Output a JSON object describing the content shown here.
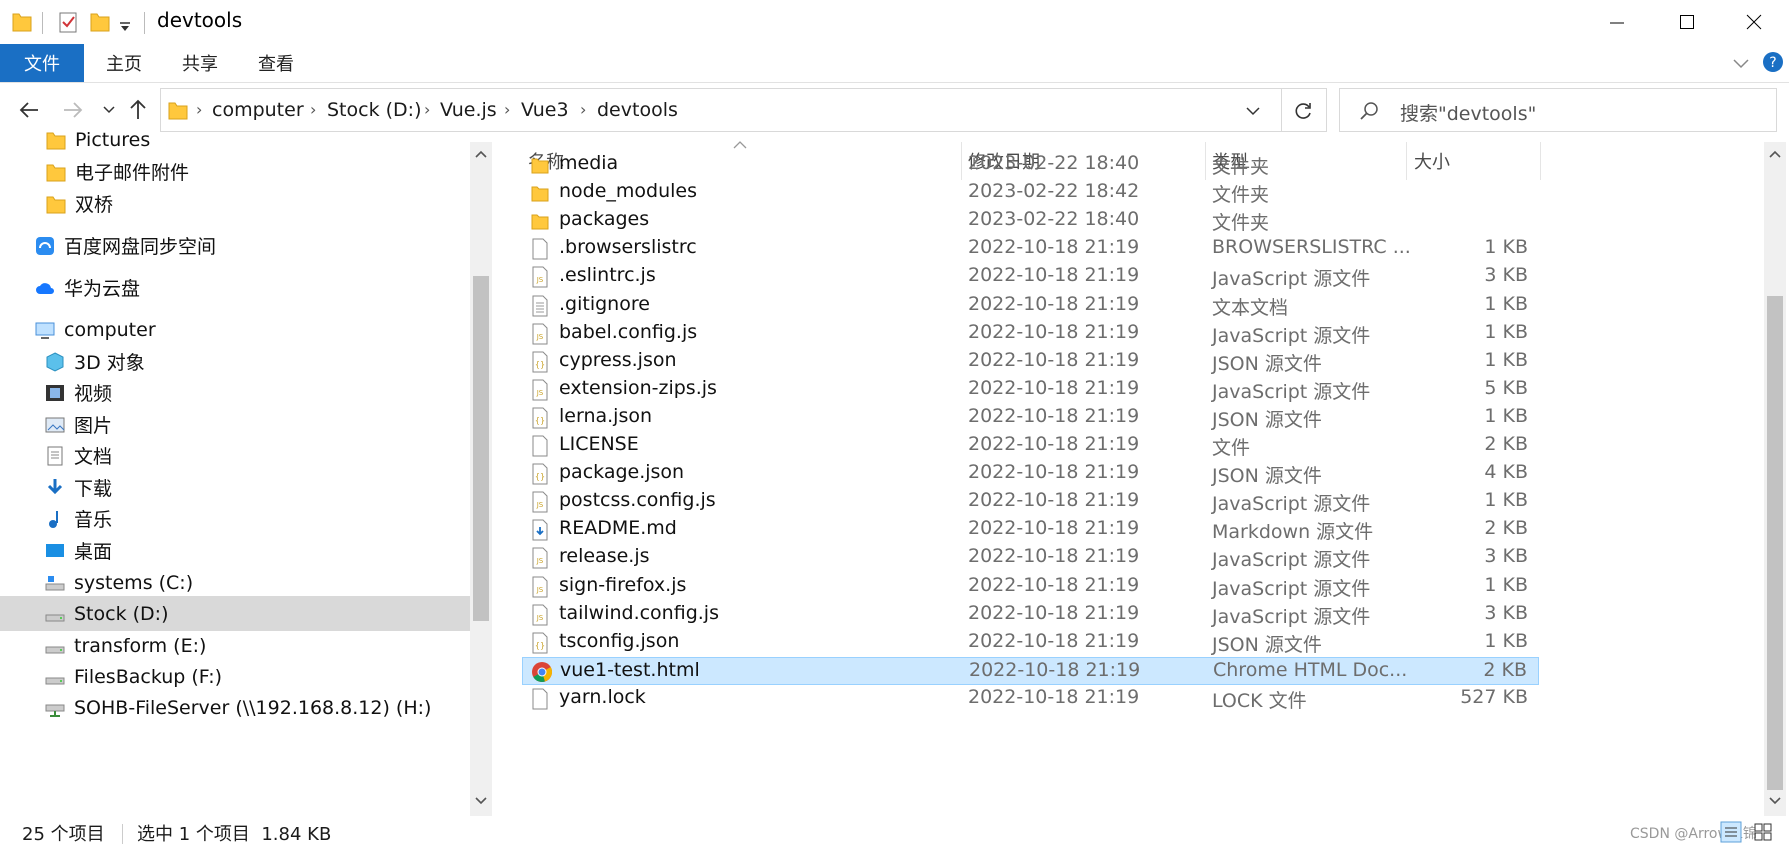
{
  "window": {
    "title": "devtools"
  },
  "ribbon": {
    "tabs": [
      "文件",
      "主页",
      "共享",
      "查看"
    ]
  },
  "breadcrumb": [
    "computer",
    "Stock (D:)",
    "Vue.js",
    "Vue3",
    "devtools"
  ],
  "search": {
    "placeholder": "搜索\"devtools\""
  },
  "nav": [
    {
      "label": "Pictures",
      "icon": "folder-icon"
    },
    {
      "label": "电子邮件附件",
      "icon": "folder-icon"
    },
    {
      "label": "双桥",
      "icon": "folder-icon"
    },
    {
      "label": "百度网盘同步空间",
      "icon": "baidu-netdisk-icon"
    },
    {
      "label": "华为云盘",
      "icon": "huawei-cloud-icon"
    },
    {
      "label": "computer",
      "icon": "computer-icon"
    },
    {
      "label": "3D 对象",
      "icon": "3d-objects-icon"
    },
    {
      "label": "视频",
      "icon": "video-icon"
    },
    {
      "label": "图片",
      "icon": "image-icon"
    },
    {
      "label": "文档",
      "icon": "document-icon"
    },
    {
      "label": "下载",
      "icon": "download-icon"
    },
    {
      "label": "音乐",
      "icon": "music-icon"
    },
    {
      "label": "桌面",
      "icon": "desktop-icon"
    },
    {
      "label": "systems (C:)",
      "icon": "system-drive-icon"
    },
    {
      "label": "Stock (D:)",
      "icon": "drive-icon"
    },
    {
      "label": "transform (E:)",
      "icon": "drive-icon"
    },
    {
      "label": "FilesBackup (F:)",
      "icon": "drive-icon"
    },
    {
      "label": "SOHB-FileServer (\\\\192.168.8.12) (H:)",
      "icon": "network-drive-icon"
    }
  ],
  "columns": {
    "name": "名称",
    "date": "修改日期",
    "type": "类型",
    "size": "大小"
  },
  "files": [
    {
      "name": "media",
      "date": "2023-02-22 18:40",
      "type": "文件夹",
      "size": "",
      "icon": "folder"
    },
    {
      "name": "node_modules",
      "date": "2023-02-22 18:42",
      "type": "文件夹",
      "size": "",
      "icon": "folder"
    },
    {
      "name": "packages",
      "date": "2023-02-22 18:40",
      "type": "文件夹",
      "size": "",
      "icon": "folder"
    },
    {
      "name": ".browserslistrc",
      "date": "2022-10-18 21:19",
      "type": "BROWSERSLISTRC ...",
      "size": "1 KB",
      "icon": "file"
    },
    {
      "name": ".eslintrc.js",
      "date": "2022-10-18 21:19",
      "type": "JavaScript 源文件",
      "size": "3 KB",
      "icon": "js"
    },
    {
      "name": ".gitignore",
      "date": "2022-10-18 21:19",
      "type": "文本文档",
      "size": "1 KB",
      "icon": "text"
    },
    {
      "name": "babel.config.js",
      "date": "2022-10-18 21:19",
      "type": "JavaScript 源文件",
      "size": "1 KB",
      "icon": "js"
    },
    {
      "name": "cypress.json",
      "date": "2022-10-18 21:19",
      "type": "JSON 源文件",
      "size": "1 KB",
      "icon": "json"
    },
    {
      "name": "extension-zips.js",
      "date": "2022-10-18 21:19",
      "type": "JavaScript 源文件",
      "size": "5 KB",
      "icon": "js"
    },
    {
      "name": "lerna.json",
      "date": "2022-10-18 21:19",
      "type": "JSON 源文件",
      "size": "1 KB",
      "icon": "json"
    },
    {
      "name": "LICENSE",
      "date": "2022-10-18 21:19",
      "type": "文件",
      "size": "2 KB",
      "icon": "file"
    },
    {
      "name": "package.json",
      "date": "2022-10-18 21:19",
      "type": "JSON 源文件",
      "size": "4 KB",
      "icon": "json"
    },
    {
      "name": "postcss.config.js",
      "date": "2022-10-18 21:19",
      "type": "JavaScript 源文件",
      "size": "1 KB",
      "icon": "js"
    },
    {
      "name": "README.md",
      "date": "2022-10-18 21:19",
      "type": "Markdown 源文件",
      "size": "2 KB",
      "icon": "markdown"
    },
    {
      "name": "release.js",
      "date": "2022-10-18 21:19",
      "type": "JavaScript 源文件",
      "size": "3 KB",
      "icon": "js"
    },
    {
      "name": "sign-firefox.js",
      "date": "2022-10-18 21:19",
      "type": "JavaScript 源文件",
      "size": "1 KB",
      "icon": "js"
    },
    {
      "name": "tailwind.config.js",
      "date": "2022-10-18 21:19",
      "type": "JavaScript 源文件",
      "size": "3 KB",
      "icon": "js"
    },
    {
      "name": "tsconfig.json",
      "date": "2022-10-18 21:19",
      "type": "JSON 源文件",
      "size": "1 KB",
      "icon": "json"
    },
    {
      "name": "vue1-test.html",
      "date": "2022-10-18 21:19",
      "type": "Chrome HTML Doc...",
      "size": "2 KB",
      "icon": "chrome"
    },
    {
      "name": "yarn.lock",
      "date": "2022-10-18 21:19",
      "type": "LOCK 文件",
      "size": "527 KB",
      "icon": "file"
    }
  ],
  "status": {
    "count": "25 个项目",
    "selected": "选中 1 个项目  1.84 KB"
  },
  "watermark": "CSDN @Arrow江锦",
  "colors": {
    "accent": "#1a6fc4",
    "selection": "#cce8ff",
    "folder": "#ffc83d"
  }
}
